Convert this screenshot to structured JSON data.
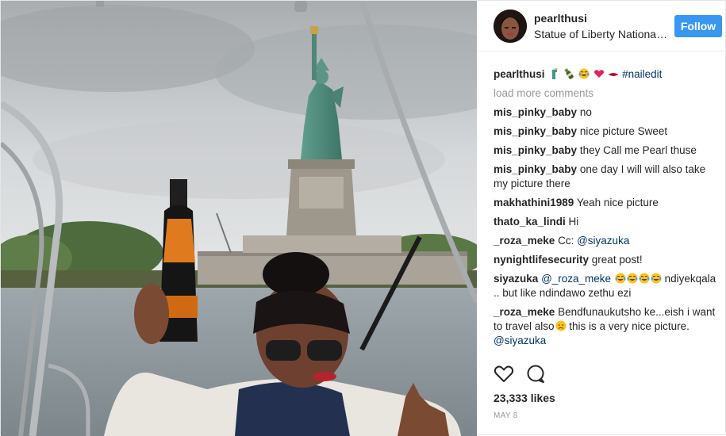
{
  "post": {
    "username": "pearlthusi",
    "location": "Statue of Liberty National Monument",
    "follow_label": "Follow"
  },
  "caption": {
    "username": "pearlthusi",
    "emojis": [
      "statue-of-liberty",
      "bottle",
      "tears-of-joy",
      "heart",
      "lips"
    ],
    "hashtag": "#nailedit"
  },
  "load_more_label": "load more comments",
  "comments": [
    {
      "user": "mis_pinky_baby",
      "text": "no"
    },
    {
      "user": "mis_pinky_baby",
      "text": "nice picture Sweet"
    },
    {
      "user": "mis_pinky_baby",
      "text": "they Call me Pearl thuse"
    },
    {
      "user": "mis_pinky_baby",
      "text": "one day I will will also take my picture there"
    },
    {
      "user": "makhathini1989",
      "text": "Yeah nice picture"
    },
    {
      "user": "thato_ka_lindi",
      "text": "Hi"
    },
    {
      "user": "_roza_meke",
      "text": "Cc:",
      "mention": "@siyazuka"
    },
    {
      "user": "nynightlifesecurity",
      "text": "great post!"
    },
    {
      "user": "siyazuka",
      "mention": "@_roza_meke",
      "text": "ndiyekqala .. but like ndindawo zethu ezi",
      "emojis": [
        "tears-of-joy",
        "tears-of-joy",
        "tears-of-joy",
        "tears-of-joy"
      ]
    },
    {
      "user": "_roza_meke",
      "text": "Bendfunaukutsho ke...eish i want to travel also",
      "text_after": " this is a very nice picture.",
      "mention": "@siyazuka",
      "emoji": "disappointed-face"
    }
  ],
  "likes": "23,333 likes",
  "date": "MAY 8",
  "icons": [
    "heart-icon",
    "comment-icon"
  ],
  "colors": {
    "follow": "#3897f0",
    "link": "#003569",
    "muted": "#999999"
  }
}
